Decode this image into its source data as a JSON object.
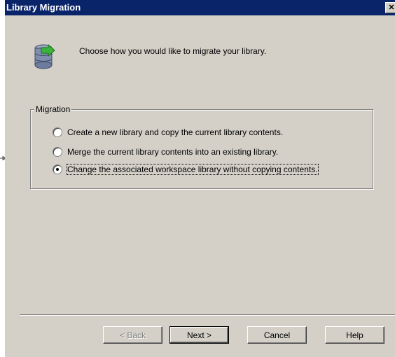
{
  "window": {
    "title": "Library Migration",
    "close_glyph": "✕"
  },
  "header": {
    "icon": "database-migrate-icon",
    "intro_text": "Choose how you would like to migrate your library."
  },
  "migration": {
    "legend": "Migration",
    "options": [
      {
        "label": "Create a new library and copy the current library contents.",
        "checked": false
      },
      {
        "label": "Merge the current library contents into an existing library.",
        "checked": false
      },
      {
        "label": "Change the associated workspace library without copying contents.",
        "checked": true
      }
    ]
  },
  "buttons": {
    "back": "< Back",
    "next": "Next >",
    "cancel": "Cancel",
    "help": "Help"
  },
  "colors": {
    "titlebar": "#0a246a",
    "dialog_bg": "#d4d0c8",
    "icon_green": "#2e9a2e"
  }
}
